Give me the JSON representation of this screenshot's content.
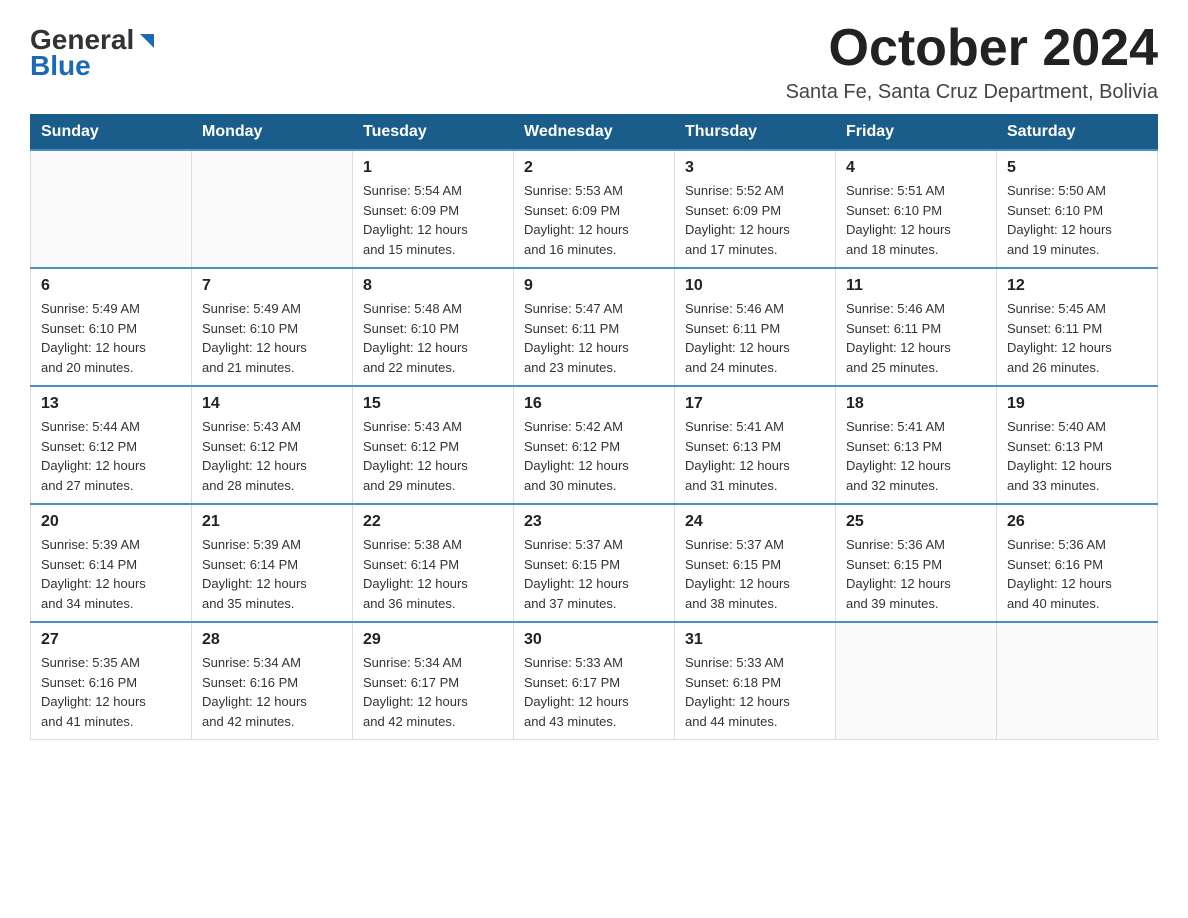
{
  "logo": {
    "general": "General",
    "blue": "Blue"
  },
  "title": "October 2024",
  "location": "Santa Fe, Santa Cruz Department, Bolivia",
  "days_of_week": [
    "Sunday",
    "Monday",
    "Tuesday",
    "Wednesday",
    "Thursday",
    "Friday",
    "Saturday"
  ],
  "weeks": [
    [
      {
        "day": "",
        "info": ""
      },
      {
        "day": "",
        "info": ""
      },
      {
        "day": "1",
        "info": "Sunrise: 5:54 AM\nSunset: 6:09 PM\nDaylight: 12 hours\nand 15 minutes."
      },
      {
        "day": "2",
        "info": "Sunrise: 5:53 AM\nSunset: 6:09 PM\nDaylight: 12 hours\nand 16 minutes."
      },
      {
        "day": "3",
        "info": "Sunrise: 5:52 AM\nSunset: 6:09 PM\nDaylight: 12 hours\nand 17 minutes."
      },
      {
        "day": "4",
        "info": "Sunrise: 5:51 AM\nSunset: 6:10 PM\nDaylight: 12 hours\nand 18 minutes."
      },
      {
        "day": "5",
        "info": "Sunrise: 5:50 AM\nSunset: 6:10 PM\nDaylight: 12 hours\nand 19 minutes."
      }
    ],
    [
      {
        "day": "6",
        "info": "Sunrise: 5:49 AM\nSunset: 6:10 PM\nDaylight: 12 hours\nand 20 minutes."
      },
      {
        "day": "7",
        "info": "Sunrise: 5:49 AM\nSunset: 6:10 PM\nDaylight: 12 hours\nand 21 minutes."
      },
      {
        "day": "8",
        "info": "Sunrise: 5:48 AM\nSunset: 6:10 PM\nDaylight: 12 hours\nand 22 minutes."
      },
      {
        "day": "9",
        "info": "Sunrise: 5:47 AM\nSunset: 6:11 PM\nDaylight: 12 hours\nand 23 minutes."
      },
      {
        "day": "10",
        "info": "Sunrise: 5:46 AM\nSunset: 6:11 PM\nDaylight: 12 hours\nand 24 minutes."
      },
      {
        "day": "11",
        "info": "Sunrise: 5:46 AM\nSunset: 6:11 PM\nDaylight: 12 hours\nand 25 minutes."
      },
      {
        "day": "12",
        "info": "Sunrise: 5:45 AM\nSunset: 6:11 PM\nDaylight: 12 hours\nand 26 minutes."
      }
    ],
    [
      {
        "day": "13",
        "info": "Sunrise: 5:44 AM\nSunset: 6:12 PM\nDaylight: 12 hours\nand 27 minutes."
      },
      {
        "day": "14",
        "info": "Sunrise: 5:43 AM\nSunset: 6:12 PM\nDaylight: 12 hours\nand 28 minutes."
      },
      {
        "day": "15",
        "info": "Sunrise: 5:43 AM\nSunset: 6:12 PM\nDaylight: 12 hours\nand 29 minutes."
      },
      {
        "day": "16",
        "info": "Sunrise: 5:42 AM\nSunset: 6:12 PM\nDaylight: 12 hours\nand 30 minutes."
      },
      {
        "day": "17",
        "info": "Sunrise: 5:41 AM\nSunset: 6:13 PM\nDaylight: 12 hours\nand 31 minutes."
      },
      {
        "day": "18",
        "info": "Sunrise: 5:41 AM\nSunset: 6:13 PM\nDaylight: 12 hours\nand 32 minutes."
      },
      {
        "day": "19",
        "info": "Sunrise: 5:40 AM\nSunset: 6:13 PM\nDaylight: 12 hours\nand 33 minutes."
      }
    ],
    [
      {
        "day": "20",
        "info": "Sunrise: 5:39 AM\nSunset: 6:14 PM\nDaylight: 12 hours\nand 34 minutes."
      },
      {
        "day": "21",
        "info": "Sunrise: 5:39 AM\nSunset: 6:14 PM\nDaylight: 12 hours\nand 35 minutes."
      },
      {
        "day": "22",
        "info": "Sunrise: 5:38 AM\nSunset: 6:14 PM\nDaylight: 12 hours\nand 36 minutes."
      },
      {
        "day": "23",
        "info": "Sunrise: 5:37 AM\nSunset: 6:15 PM\nDaylight: 12 hours\nand 37 minutes."
      },
      {
        "day": "24",
        "info": "Sunrise: 5:37 AM\nSunset: 6:15 PM\nDaylight: 12 hours\nand 38 minutes."
      },
      {
        "day": "25",
        "info": "Sunrise: 5:36 AM\nSunset: 6:15 PM\nDaylight: 12 hours\nand 39 minutes."
      },
      {
        "day": "26",
        "info": "Sunrise: 5:36 AM\nSunset: 6:16 PM\nDaylight: 12 hours\nand 40 minutes."
      }
    ],
    [
      {
        "day": "27",
        "info": "Sunrise: 5:35 AM\nSunset: 6:16 PM\nDaylight: 12 hours\nand 41 minutes."
      },
      {
        "day": "28",
        "info": "Sunrise: 5:34 AM\nSunset: 6:16 PM\nDaylight: 12 hours\nand 42 minutes."
      },
      {
        "day": "29",
        "info": "Sunrise: 5:34 AM\nSunset: 6:17 PM\nDaylight: 12 hours\nand 42 minutes."
      },
      {
        "day": "30",
        "info": "Sunrise: 5:33 AM\nSunset: 6:17 PM\nDaylight: 12 hours\nand 43 minutes."
      },
      {
        "day": "31",
        "info": "Sunrise: 5:33 AM\nSunset: 6:18 PM\nDaylight: 12 hours\nand 44 minutes."
      },
      {
        "day": "",
        "info": ""
      },
      {
        "day": "",
        "info": ""
      }
    ]
  ]
}
